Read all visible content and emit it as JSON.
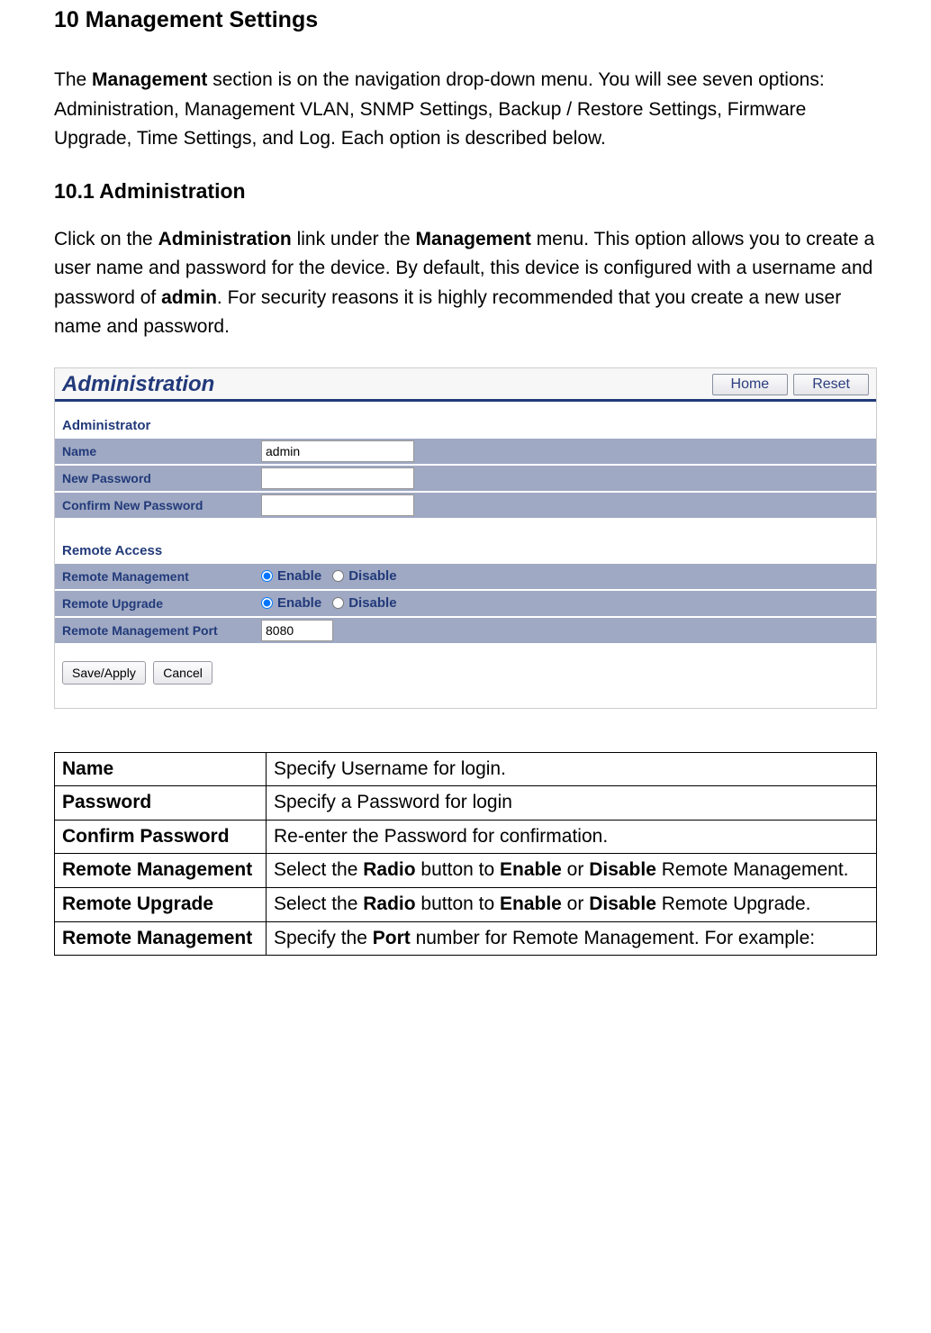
{
  "doc": {
    "h1": "10 Management Settings",
    "intro_pre": "The ",
    "intro_bold": "Management",
    "intro_post": " section is on the navigation drop-down menu. You will see seven options: Administration, Management VLAN, SNMP Settings, Backup / Restore Settings, Firmware Upgrade, Time Settings, and Log. Each option is described below.",
    "h2": "10.1 Administration",
    "p2_a": "Click on the ",
    "p2_b1": "Administration",
    "p2_c": " link under the ",
    "p2_b2": "Management",
    "p2_d": " menu. This option allows you to create a user name and password for the device. By default, this device is configured with a username and password of ",
    "p2_b3": "admin",
    "p2_e": ". For security reasons it is highly recommended that you create a new user name and password."
  },
  "panel": {
    "title": "Administration",
    "btn_home": "Home",
    "btn_reset": "Reset",
    "sec_admin": "Administrator",
    "row_name": "Name",
    "val_name": "admin",
    "row_newpw": "New Password",
    "row_confpw": "Confirm New Password",
    "sec_remote": "Remote Access",
    "row_rm": "Remote Management",
    "row_ru": "Remote Upgrade",
    "row_rmport": "Remote Management Port",
    "val_rmport": "8080",
    "opt_enable": "Enable",
    "opt_disable": "Disable",
    "btn_save": "Save/Apply",
    "btn_cancel": "Cancel"
  },
  "table": {
    "rows": [
      {
        "k": "Name",
        "v_plain": "Specify Username for login."
      },
      {
        "k": "Password",
        "v_plain": "Specify a Password for login"
      },
      {
        "k": "Confirm Password",
        "v_plain": "Re-enter the Password for confirmation."
      },
      {
        "k": "Remote Management",
        "v_parts": [
          "Select the ",
          "Radio",
          " button to ",
          "Enable",
          " or ",
          "Disable",
          " Remote Management."
        ]
      },
      {
        "k": "Remote Upgrade",
        "v_parts": [
          "Select the ",
          "Radio",
          " button to ",
          "Enable",
          " or ",
          "Disable",
          " Remote Upgrade."
        ]
      },
      {
        "k": "Remote Management",
        "v_parts": [
          "Specify the ",
          "Port",
          " number for Remote Management. For example:"
        ]
      }
    ]
  }
}
